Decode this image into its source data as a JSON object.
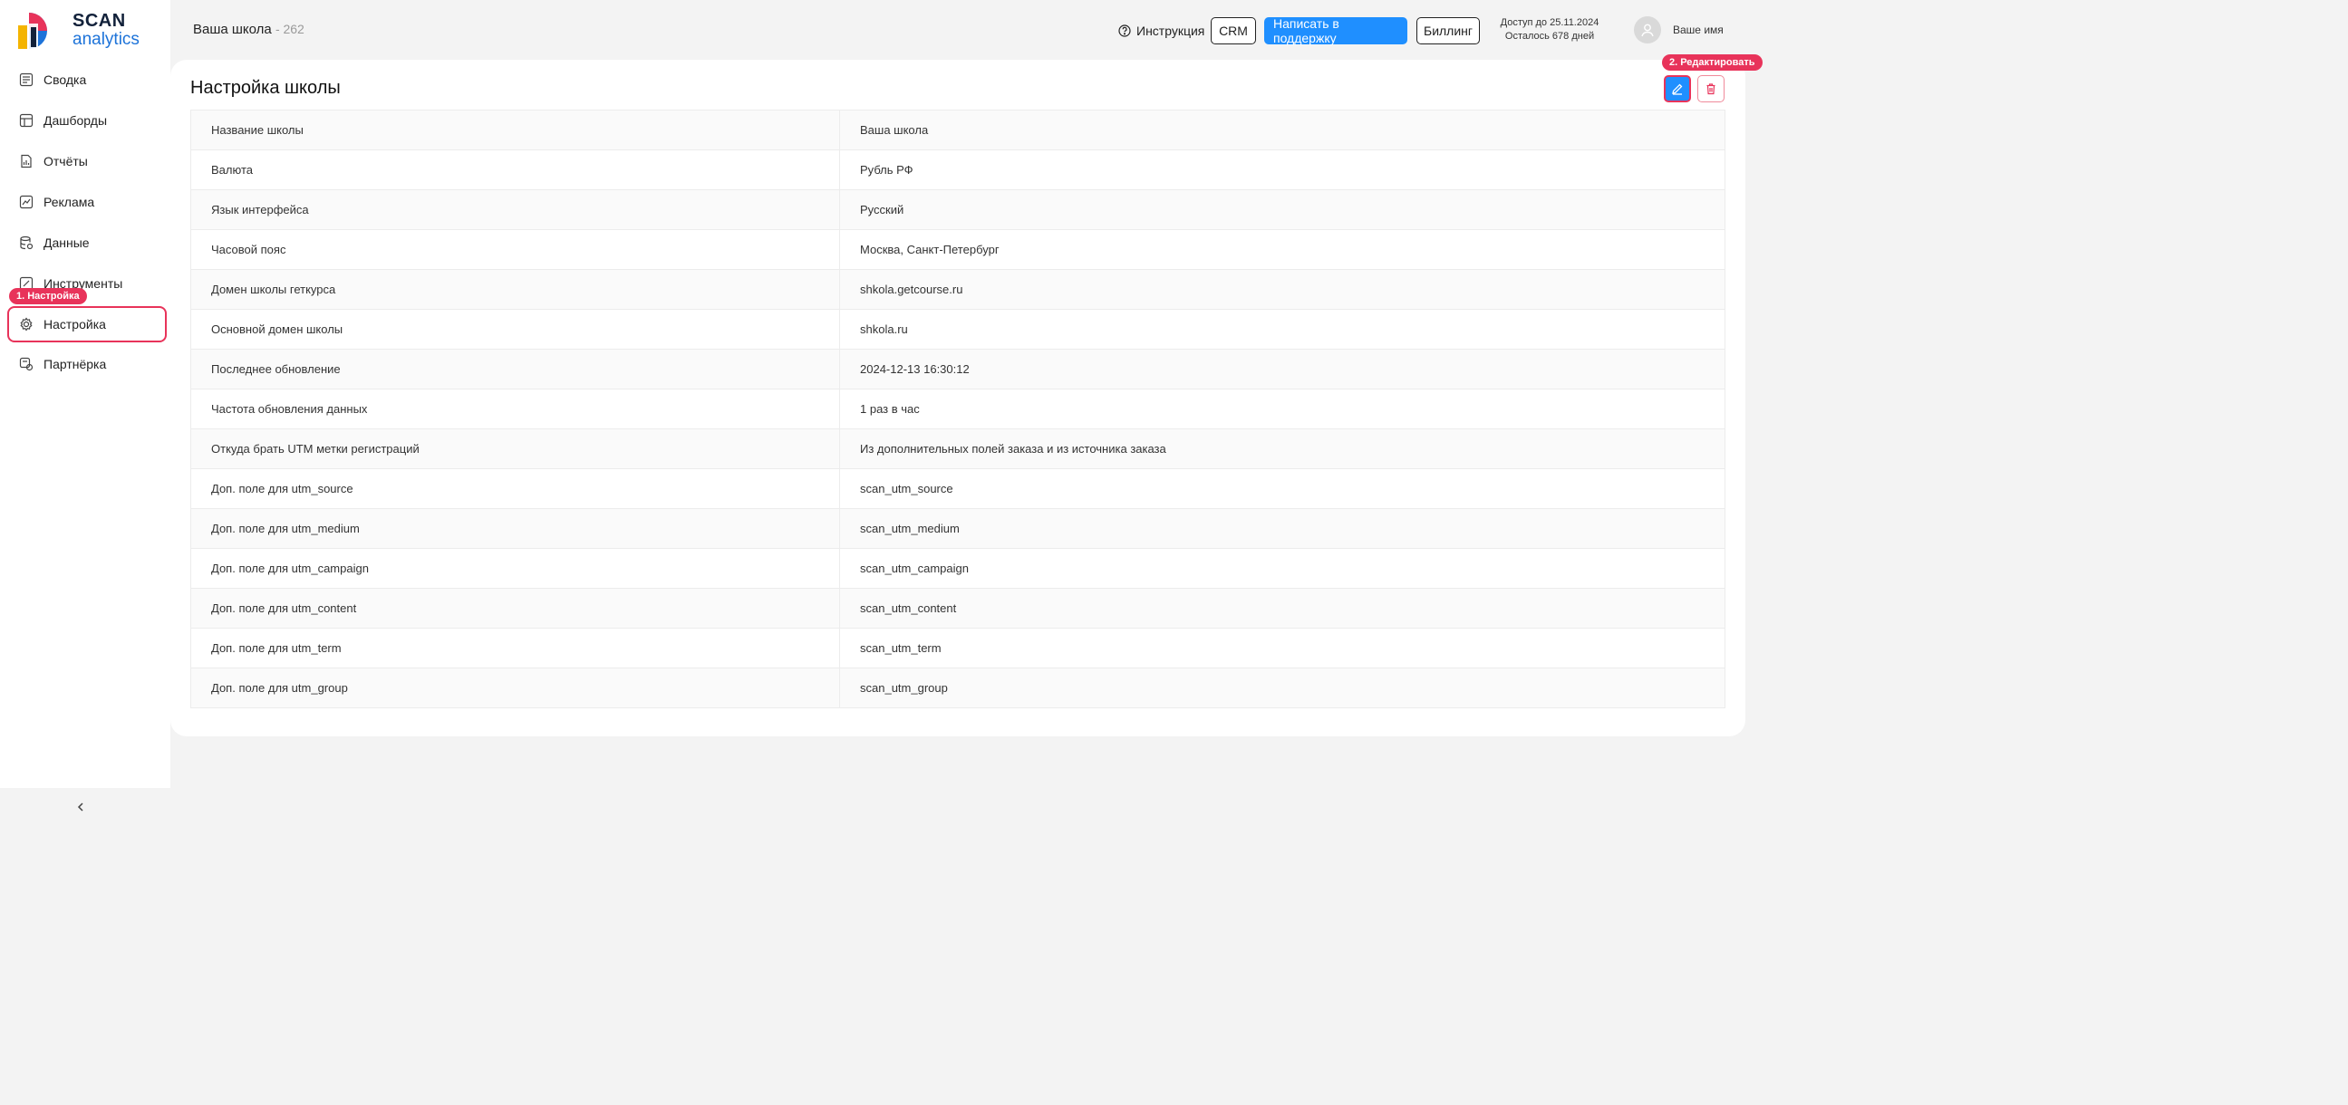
{
  "logo": {
    "line1": "SCAN",
    "line2": "analytics"
  },
  "sidebar": {
    "items": [
      {
        "label": "Сводка",
        "icon": "summary-icon"
      },
      {
        "label": "Дашборды",
        "icon": "dashboard-icon"
      },
      {
        "label": "Отчёты",
        "icon": "report-icon"
      },
      {
        "label": "Реклама",
        "icon": "ads-icon"
      },
      {
        "label": "Данные",
        "icon": "database-icon"
      },
      {
        "label": "Инструменты",
        "icon": "tools-icon"
      },
      {
        "label": "Настройка",
        "icon": "gear-icon"
      },
      {
        "label": "Партнёрка",
        "icon": "partner-icon"
      }
    ],
    "settings_badge": "1. Настройка"
  },
  "header": {
    "school": "Ваша школа",
    "count": "- 262",
    "instruction": "Инструкция",
    "crm": "CRM",
    "support": "Написать в поддержку",
    "billing": "Биллинг",
    "access_line1": "Доступ до 25.11.2024",
    "access_line2": "Осталось 678 дней",
    "username": "Ваше имя"
  },
  "card": {
    "title": "Настройка школы",
    "edit_badge": "2. Редактировать",
    "rows": [
      {
        "key": "Название школы",
        "value": "Ваша школа"
      },
      {
        "key": "Валюта",
        "value": "Рубль РФ"
      },
      {
        "key": "Язык интерфейса",
        "value": "Русский"
      },
      {
        "key": "Часовой пояс",
        "value": "Москва, Санкт-Петербург"
      },
      {
        "key": "Домен школы геткурса",
        "value": "shkola.getcourse.ru"
      },
      {
        "key": "Основной домен школы",
        "value": "shkola.ru"
      },
      {
        "key": "Последнее обновление",
        "value": "2024-12-13 16:30:12"
      },
      {
        "key": "Частота обновления данных",
        "value": "1 раз в час"
      },
      {
        "key": "Откуда брать UTM метки регистраций",
        "value": "Из дополнительных полей заказа и из источника заказа"
      },
      {
        "key": "Доп. поле для utm_source",
        "value": "scan_utm_source"
      },
      {
        "key": "Доп. поле для utm_medium",
        "value": "scan_utm_medium"
      },
      {
        "key": "Доп. поле для utm_campaign",
        "value": "scan_utm_campaign"
      },
      {
        "key": "Доп. поле для utm_content",
        "value": "scan_utm_content"
      },
      {
        "key": "Доп. поле для utm_term",
        "value": "scan_utm_term"
      },
      {
        "key": "Доп. поле для utm_group",
        "value": "scan_utm_group"
      }
    ]
  },
  "colors": {
    "accent": "#1f8fff",
    "highlight": "#e8335a"
  }
}
